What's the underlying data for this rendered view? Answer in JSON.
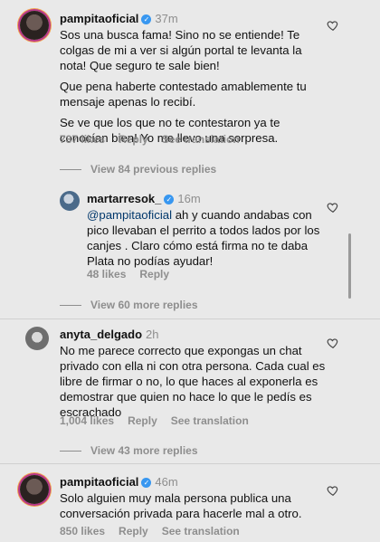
{
  "comments": [
    {
      "username": "pampitaoficial",
      "time": "37m",
      "paragraphs": [
        "Sos una busca fama! Sino no se entiende! Te colgas de mi a ver si algún portal te levanta la nota! Que seguro te sale bien!",
        "Que pena haberte contestado amablemente tu mensaje apenas lo recibí.",
        "Se ve que los que no te contestaron ya te conocían bien! Yo me llevo una sorpresa."
      ],
      "likes": "737 likes",
      "reply": "Reply",
      "translation": "See translation",
      "view_more": "View 84 previous replies"
    },
    {
      "username": "martarresok_",
      "time": "16m",
      "mention": "@pampitaoficial",
      "text": " ah y cuando andabas con pico llevaban el perrito a todos lados por los canjes . Claro cómo está firma no te daba Plata no podías ayudar!",
      "likes": "48 likes",
      "reply": "Reply",
      "view_more": "View 60 more replies"
    },
    {
      "username": "anyta_delgado",
      "time": "2h",
      "text": "No me parece correcto que expongas un chat privado con ella ni con otra persona. Cada cual es libre de firmar o no, lo que haces al exponerla es demostrar que quien no hace lo que le pedís es escrachado",
      "likes": "1,004 likes",
      "reply": "Reply",
      "translation": "See translation",
      "view_more": "View 43 more replies"
    },
    {
      "username": "pampitaoficial",
      "time": "46m",
      "text": "Solo alguien muy mala persona publica una conversación privada para hacerle mal a otro.",
      "likes": "850 likes",
      "reply": "Reply",
      "translation": "See translation"
    }
  ],
  "icons": {
    "verified": "✓"
  }
}
